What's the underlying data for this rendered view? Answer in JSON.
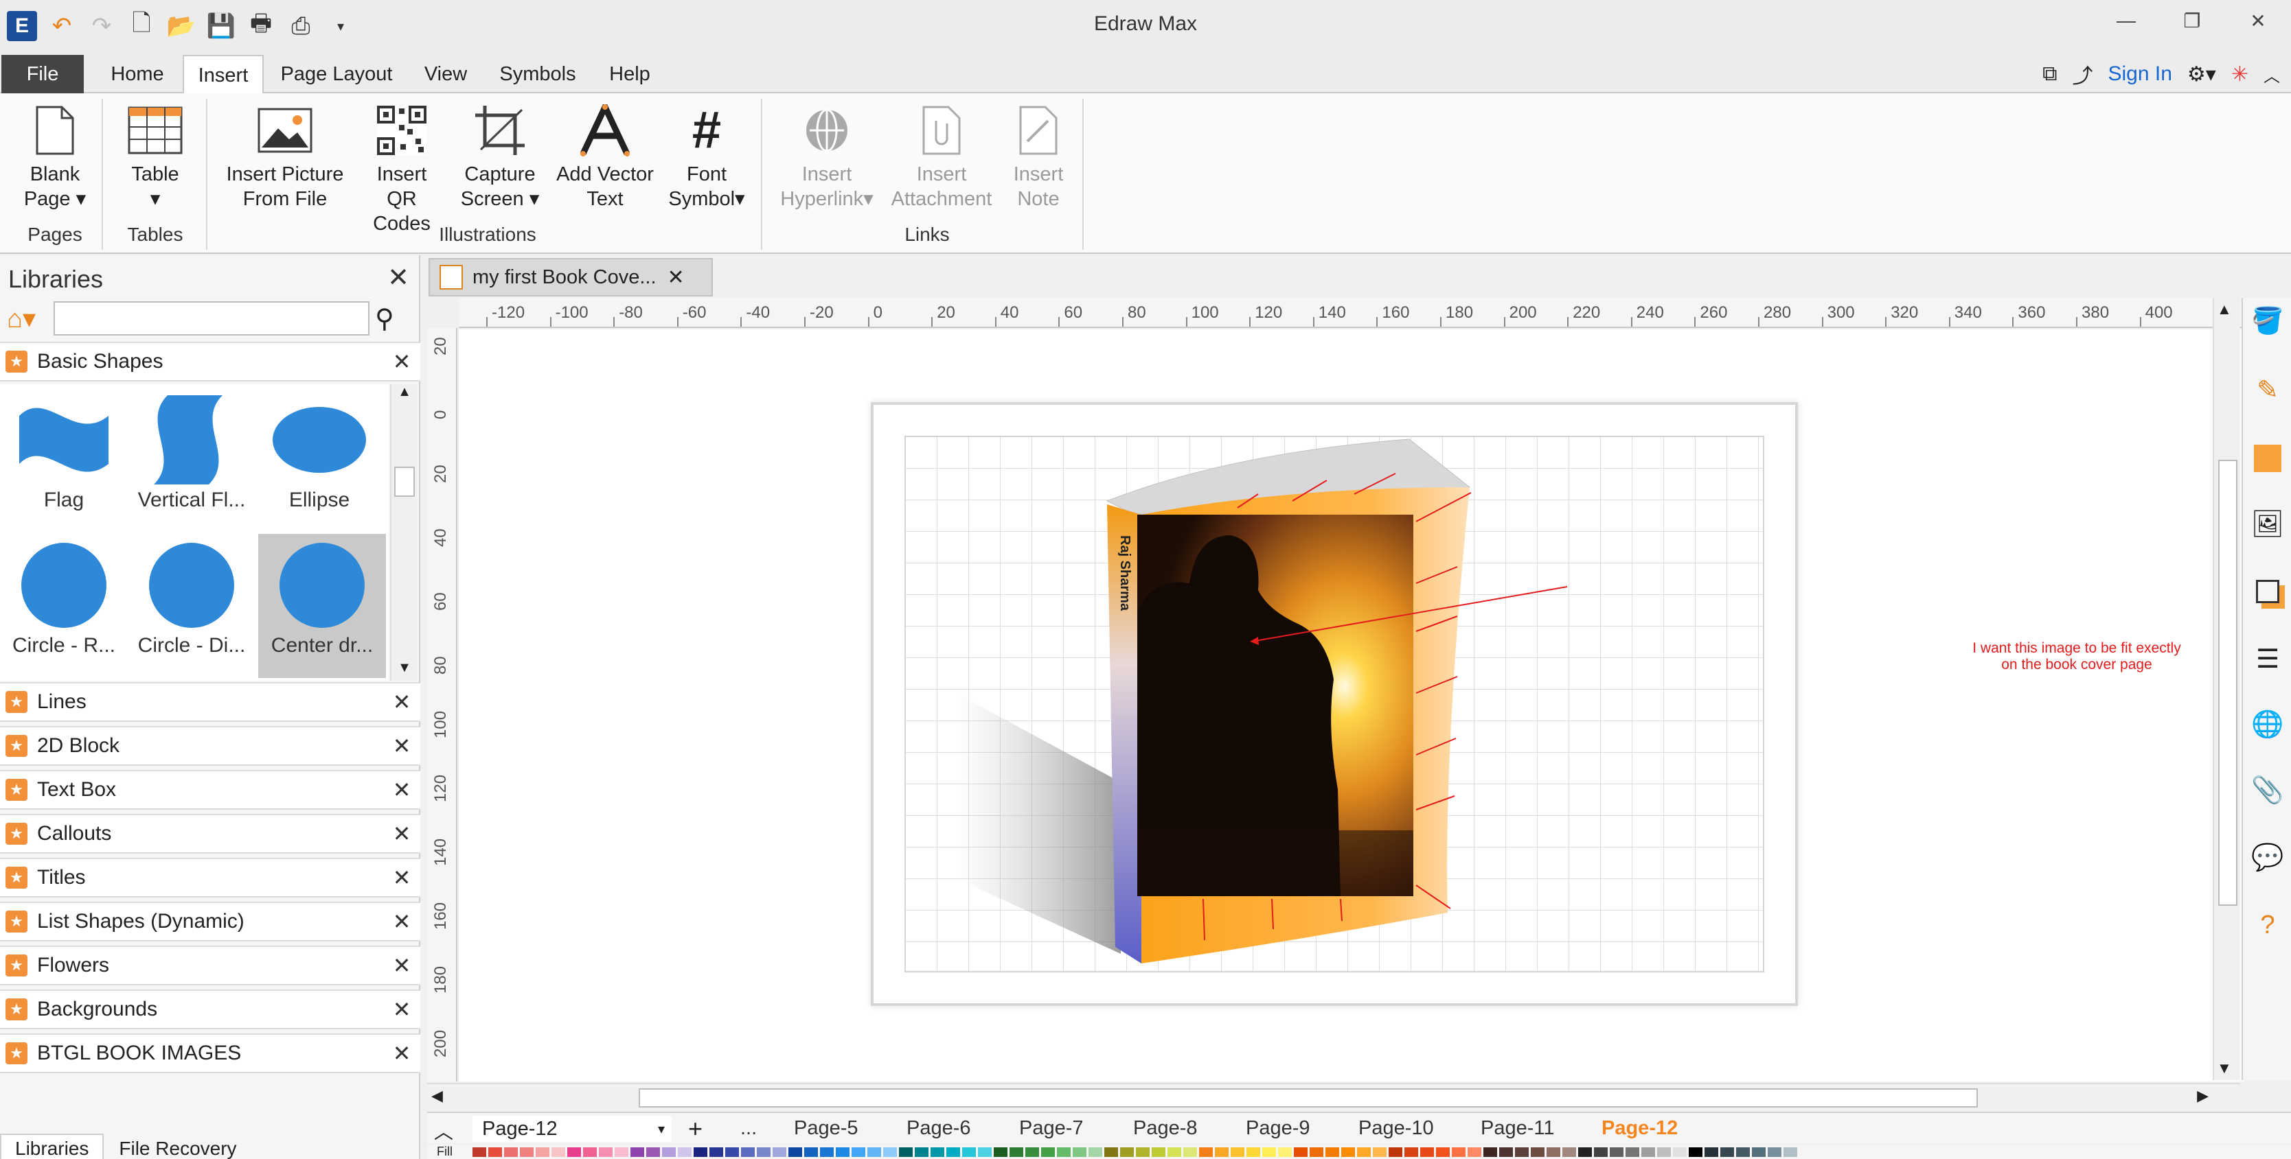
{
  "app": {
    "title": "Edraw Max"
  },
  "menu": {
    "tabs": [
      "File",
      "Home",
      "Insert",
      "Page Layout",
      "View",
      "Symbols",
      "Help"
    ],
    "active": "Insert",
    "sign_in": "Sign In"
  },
  "ribbon": {
    "buttons": [
      {
        "label1": "Blank",
        "label2": "Page ▾"
      },
      {
        "label1": "Table",
        "label2": "▾"
      },
      {
        "label1": "Insert Picture",
        "label2": "From File"
      },
      {
        "label1": "Insert",
        "label2": "QR Codes"
      },
      {
        "label1": "Capture",
        "label2": "Screen ▾"
      },
      {
        "label1": "Add Vector",
        "label2": "Text"
      },
      {
        "label1": "Font",
        "label2": "Symbol▾"
      },
      {
        "label1": "Insert",
        "label2": "Hyperlink▾"
      },
      {
        "label1": "Insert",
        "label2": "Attachment"
      },
      {
        "label1": "Insert",
        "label2": "Note"
      }
    ],
    "groups": [
      "Pages",
      "Tables",
      "Illustrations",
      "Links"
    ]
  },
  "libraries": {
    "title": "Libraries",
    "search_placeholder": "",
    "open_category": "Basic Shapes",
    "shapes": [
      "Flag",
      "Vertical Fl...",
      "Ellipse",
      "Circle - R...",
      "Circle - Di...",
      "Center dr..."
    ],
    "categories": [
      "Lines",
      "2D Block",
      "Text Box",
      "Callouts",
      "Titles",
      "List Shapes (Dynamic)",
      "Flowers",
      "Backgrounds",
      "BTGL BOOK IMAGES"
    ],
    "bottom_tabs": [
      "Libraries",
      "File Recovery"
    ]
  },
  "document": {
    "tab_title": "my first Book Cove...",
    "annotation_line1": "I want this image to be fit exectly",
    "annotation_line2": "on the book cover page",
    "spine_text": "Raj Sharma"
  },
  "ruler": {
    "h_ticks": [
      "-120",
      "-100",
      "-80",
      "-60",
      "-40",
      "-20",
      "0",
      "20",
      "40",
      "60",
      "80",
      "100",
      "120",
      "140",
      "160",
      "180",
      "200",
      "220",
      "240",
      "260",
      "280",
      "300",
      "320",
      "340",
      "360",
      "380",
      "400"
    ],
    "v_ticks": [
      "20",
      "0",
      "20",
      "40",
      "60",
      "80",
      "100",
      "120",
      "140",
      "160",
      "180",
      "200"
    ]
  },
  "pages": {
    "current": "Page-12",
    "more": "...",
    "tabs": [
      "Page-5",
      "Page-6",
      "Page-7",
      "Page-8",
      "Page-9",
      "Page-10",
      "Page-11",
      "Page-12"
    ],
    "active": "Page-12"
  },
  "colorbar": {
    "label": "Fill",
    "swatches": [
      "#c0392b",
      "#e74c3c",
      "#ec6f6f",
      "#f08080",
      "#f4a3a3",
      "#f6c4c4",
      "#e83e8c",
      "#f06292",
      "#f48fb1",
      "#f8bbd0",
      "#8e44ad",
      "#9b59b6",
      "#b39ddb",
      "#d1c4e9",
      "#1a237e",
      "#283593",
      "#3949ab",
      "#5c6bc0",
      "#7986cb",
      "#9fa8da",
      "#0d47a1",
      "#1565c0",
      "#1976d2",
      "#1e88e5",
      "#42a5f5",
      "#64b5f6",
      "#90caf9",
      "#006064",
      "#00838f",
      "#0097a7",
      "#00acc1",
      "#26c6da",
      "#4dd0e1",
      "#1b5e20",
      "#2e7d32",
      "#388e3c",
      "#43a047",
      "#66bb6a",
      "#81c784",
      "#a5d6a7",
      "#827717",
      "#9e9d24",
      "#afb42b",
      "#c0ca33",
      "#d4e157",
      "#dce775",
      "#f57f17",
      "#f9a825",
      "#fbc02d",
      "#fdd835",
      "#ffee58",
      "#fff176",
      "#e65100",
      "#ef6c00",
      "#f57c00",
      "#fb8c00",
      "#ffa726",
      "#ffb74d",
      "#bf360c",
      "#d84315",
      "#e64a19",
      "#f4511e",
      "#ff7043",
      "#ff8a65",
      "#3e2723",
      "#4e342e",
      "#5d4037",
      "#6d4c41",
      "#8d6e63",
      "#a1887f",
      "#212121",
      "#424242",
      "#616161",
      "#757575",
      "#9e9e9e",
      "#bdbdbd",
      "#e0e0e0",
      "#000000",
      "#263238",
      "#37474f",
      "#455a64",
      "#546e7a",
      "#78909c",
      "#b0bec5"
    ]
  }
}
